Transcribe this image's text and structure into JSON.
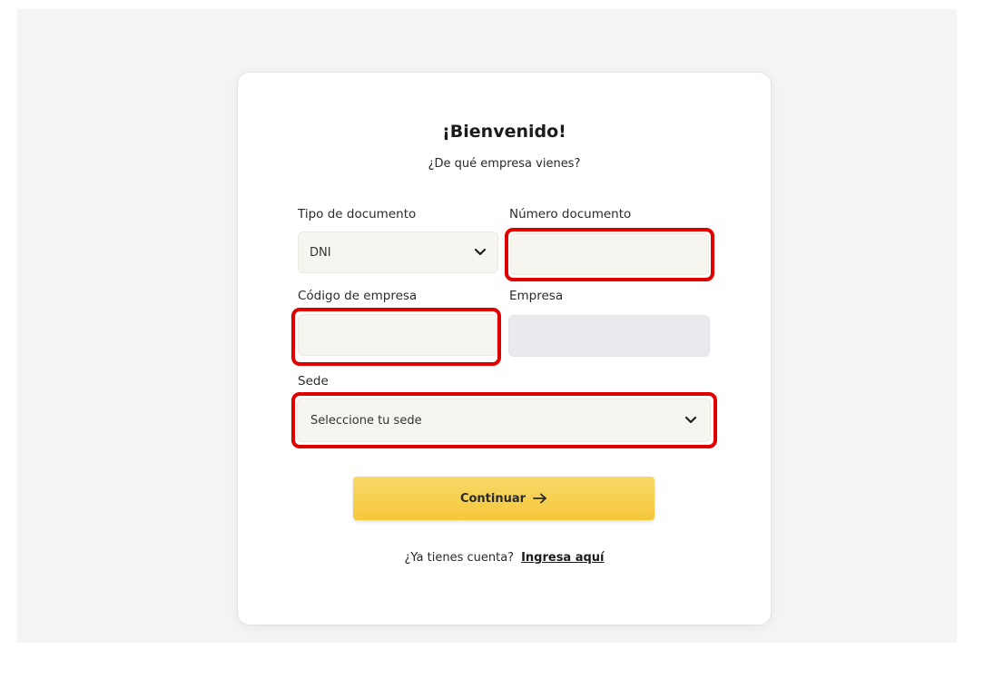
{
  "card": {
    "title": "¡Bienvenido!",
    "subtitle": "¿De qué empresa vienes?"
  },
  "form": {
    "doc_type": {
      "label": "Tipo de documento",
      "value": "DNI",
      "icon": "chevron-down-icon"
    },
    "doc_number": {
      "label": "Número documento",
      "value": ""
    },
    "company_code": {
      "label": "Código de empresa",
      "value": ""
    },
    "company": {
      "label": "Empresa",
      "value": ""
    },
    "site": {
      "label": "Sede",
      "value": "Seleccione tu sede",
      "icon": "chevron-down-icon"
    }
  },
  "actions": {
    "continue_label": "Continuar",
    "continue_icon": "arrow-right-icon",
    "account_prompt": "¿Ya tienes cuenta?",
    "login_link": "Ingresa aquí"
  },
  "colors": {
    "highlight": "#e00000",
    "button": "#f5c83a",
    "field_bg": "#f7f5ef",
    "readonly_bg": "#e8eaee"
  }
}
